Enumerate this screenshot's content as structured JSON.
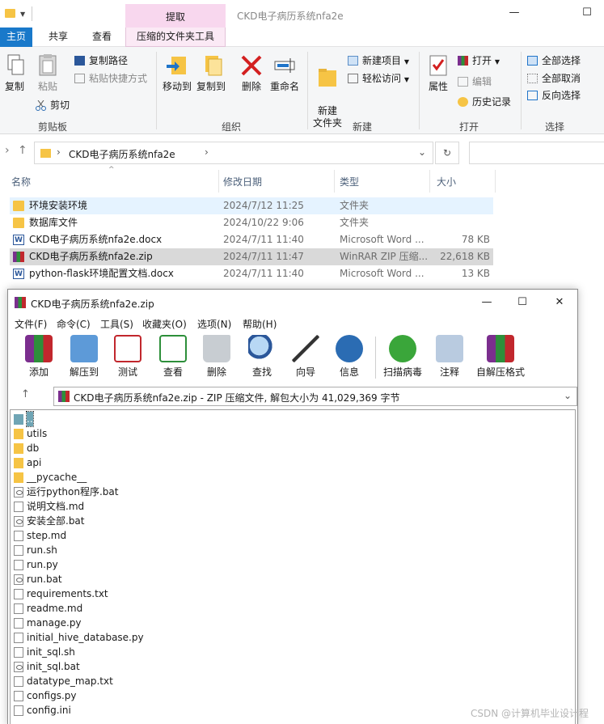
{
  "explorer": {
    "window_title": "CKD电子病历系统nfa2e",
    "context_tab_header": "提取",
    "tabs": [
      "主页",
      "共享",
      "查看",
      "压缩的文件夹工具"
    ],
    "ribbon": {
      "clipboard": {
        "label": "剪贴板",
        "copy": "复制",
        "paste": "粘贴",
        "copy_path": "复制路径",
        "paste_shortcut": "粘贴快捷方式",
        "cut": "剪切"
      },
      "organize": {
        "label": "组织",
        "move_to": "移动到",
        "copy_to": "复制到",
        "delete": "删除",
        "rename": "重命名"
      },
      "new": {
        "label": "新建",
        "new_folder": "新建\n文件夹",
        "new_item": "新建项目",
        "easy_access": "轻松访问"
      },
      "open": {
        "label": "打开",
        "properties": "属性",
        "open": "打开",
        "edit": "编辑",
        "history": "历史记录"
      },
      "select": {
        "label": "选择",
        "select_all": "全部选择",
        "select_none": "全部取消",
        "invert": "反向选择"
      }
    },
    "address": {
      "path": "CKD电子病历系统nfa2e"
    },
    "columns": {
      "name": "名称",
      "date": "修改日期",
      "type": "类型",
      "size": "大小"
    },
    "files": [
      {
        "name": "环境安装环境",
        "date": "2024/7/12 11:25",
        "type": "文件夹",
        "size": ""
      },
      {
        "name": "数据库文件",
        "date": "2024/10/22 9:06",
        "type": "文件夹",
        "size": ""
      },
      {
        "name": "CKD电子病历系统nfa2e.docx",
        "date": "2024/7/11 11:40",
        "type": "Microsoft Word ...",
        "size": "78 KB"
      },
      {
        "name": "CKD电子病历系统nfa2e.zip",
        "date": "2024/7/11 11:47",
        "type": "WinRAR ZIP 压缩...",
        "size": "22,618 KB"
      },
      {
        "name": "python-flask环境配置文档.docx",
        "date": "2024/7/11 11:40",
        "type": "Microsoft Word ...",
        "size": "13 KB"
      }
    ]
  },
  "winrar": {
    "title": "CKD电子病历系统nfa2e.zip",
    "menu": [
      "文件(F)",
      "命令(C)",
      "工具(S)",
      "收藏夹(O)",
      "选项(N)",
      "帮助(H)"
    ],
    "tools": [
      "添加",
      "解压到",
      "测试",
      "查看",
      "删除",
      "查找",
      "向导",
      "信息",
      "扫描病毒",
      "注释",
      "自解压格式"
    ],
    "path_text": "CKD电子病历系统nfa2e.zip - ZIP 压缩文件, 解包大小为 41,029,369 字节",
    "items": [
      {
        "name": "..",
        "kind": "up"
      },
      {
        "name": "utils",
        "kind": "folder"
      },
      {
        "name": "db",
        "kind": "folder"
      },
      {
        "name": "api",
        "kind": "folder"
      },
      {
        "name": "__pycache__",
        "kind": "folder"
      },
      {
        "name": "运行python程序.bat",
        "kind": "bat"
      },
      {
        "name": "说明文档.md",
        "kind": "file"
      },
      {
        "name": "安装全部.bat",
        "kind": "bat"
      },
      {
        "name": "step.md",
        "kind": "file"
      },
      {
        "name": "run.sh",
        "kind": "file"
      },
      {
        "name": "run.py",
        "kind": "file"
      },
      {
        "name": "run.bat",
        "kind": "bat"
      },
      {
        "name": "requirements.txt",
        "kind": "file"
      },
      {
        "name": "readme.md",
        "kind": "file"
      },
      {
        "name": "manage.py",
        "kind": "file"
      },
      {
        "name": "initial_hive_database.py",
        "kind": "file"
      },
      {
        "name": "init_sql.sh",
        "kind": "file"
      },
      {
        "name": "init_sql.bat",
        "kind": "bat"
      },
      {
        "name": "datatype_map.txt",
        "kind": "file"
      },
      {
        "name": "configs.py",
        "kind": "file"
      },
      {
        "name": "config.ini",
        "kind": "file"
      }
    ]
  },
  "watermark": "CSDN @计算机毕业设计程"
}
